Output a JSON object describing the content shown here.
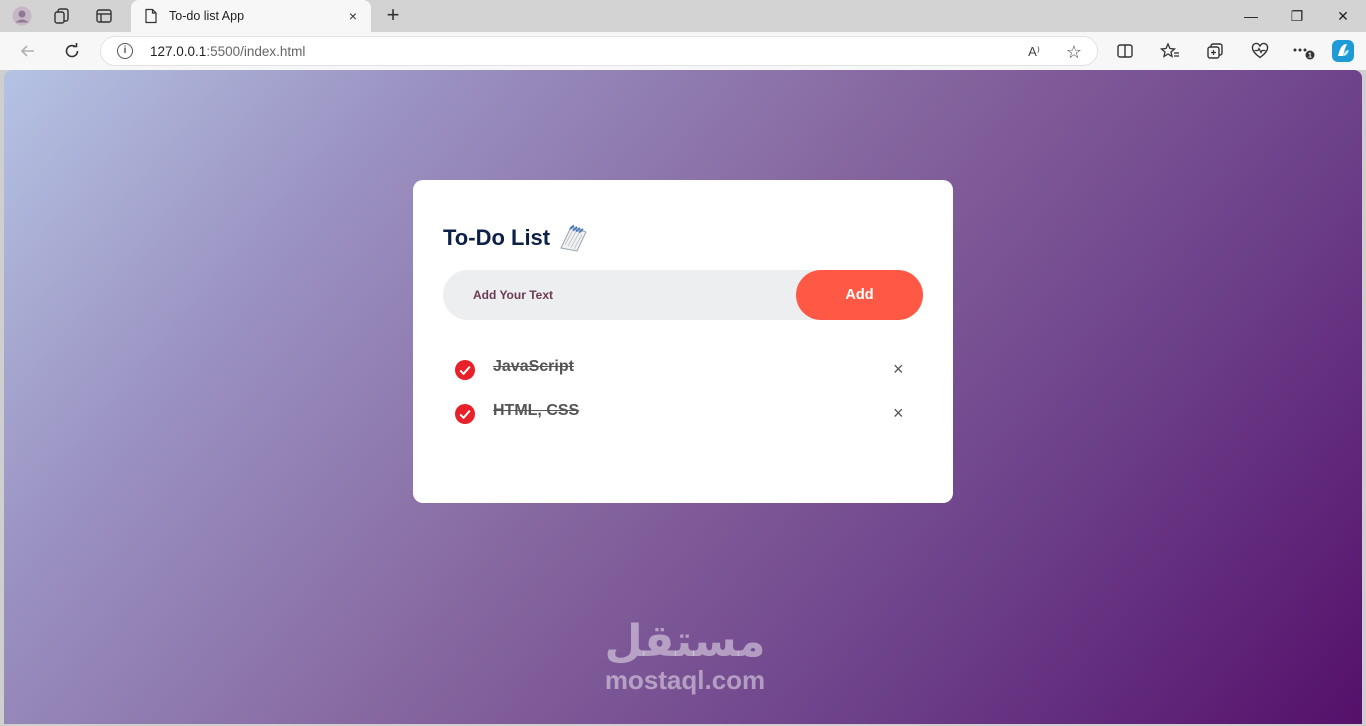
{
  "browser": {
    "tab_title": "To-do list App",
    "tab_close": "×",
    "new_tab": "+",
    "url_host": "127.0.0.1",
    "url_path": ":5500/index.html",
    "read_aloud": "A⁾",
    "favorite": "☆",
    "window_minimize": "—",
    "window_restore": "❐",
    "window_close": "✕"
  },
  "app": {
    "title": "To-Do List",
    "input_placeholder": "Add Your Text",
    "add_label": "Add",
    "delete_symbol": "×",
    "todos": [
      {
        "text": "JavaScript",
        "done": true
      },
      {
        "text": "HTML, CSS",
        "done": true
      }
    ]
  },
  "watermark": {
    "arabic": "مستقل",
    "latin": "mostaql.com"
  },
  "colors": {
    "accent": "#ff5945",
    "check": "#e8202a",
    "title": "#0d2046"
  }
}
